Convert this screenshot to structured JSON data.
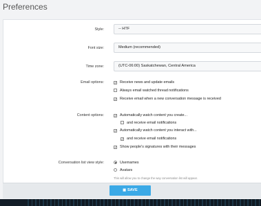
{
  "page": {
    "title": "Preferences"
  },
  "style": {
    "label": "Style:",
    "value": "-- HTF"
  },
  "font_size": {
    "label": "Font size:",
    "value": "Medium (recommended)"
  },
  "time_zone": {
    "label": "Time zone:",
    "value": "(UTC-06:00) Saskatchewan, Central America"
  },
  "email_options": {
    "label": "Email options:",
    "items": [
      {
        "label": "Receive news and update emails",
        "checked": true
      },
      {
        "label": "Always email watched thread notifications",
        "checked": false
      },
      {
        "label": "Receive email when a new conversation message is received",
        "checked": true
      }
    ]
  },
  "content_options": {
    "label": "Content options:",
    "items": [
      {
        "label": "Automatically watch content you create...",
        "checked": true
      },
      {
        "label": "and receive email notifications",
        "checked": false
      },
      {
        "label": "Automatically watch content you interact with...",
        "checked": true
      },
      {
        "label": "and receive email notifications",
        "checked": true
      },
      {
        "label": "Show people's signatures with their messages",
        "checked": true
      }
    ]
  },
  "conversation_list": {
    "label": "Conversation list view style:",
    "options": [
      {
        "label": "Usernames",
        "selected": true
      },
      {
        "label": "Avatars",
        "selected": false
      }
    ],
    "hint": "This will allow you to change the way conversation list will appear."
  },
  "footer": {
    "save_label": "SAVE",
    "save_icon": "save-icon"
  },
  "colors": {
    "accent": "#3ba9e6",
    "background": "#1b2733"
  }
}
